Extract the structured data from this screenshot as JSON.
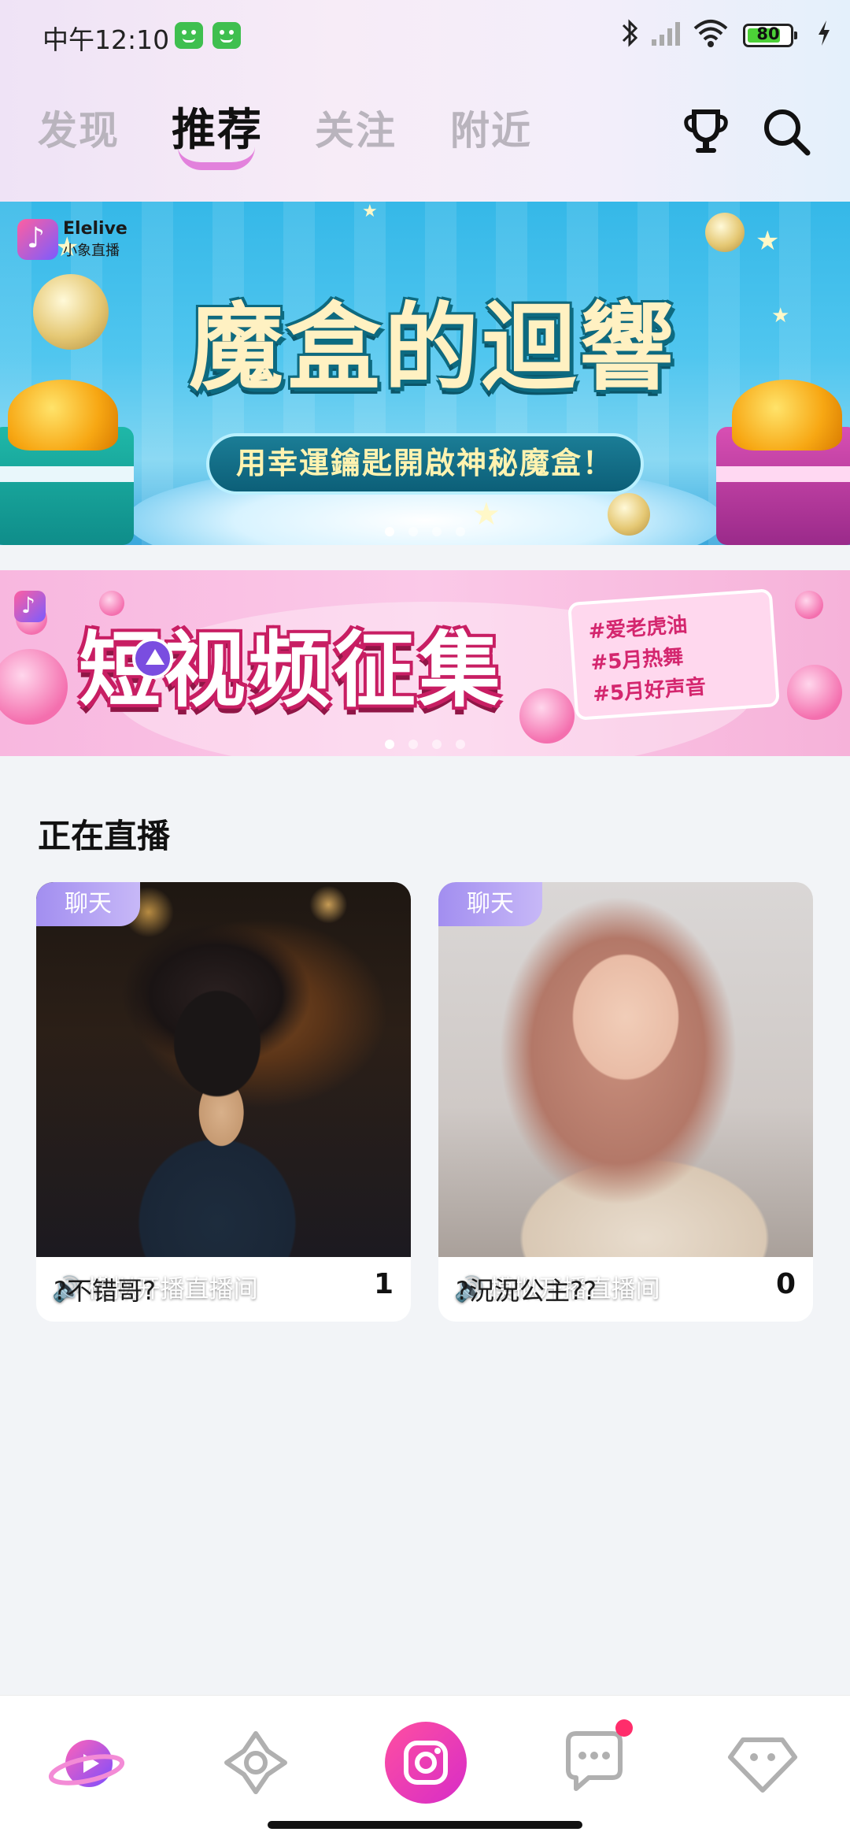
{
  "status_bar": {
    "time": "中午12:10",
    "battery": "80"
  },
  "tabs": [
    {
      "label": "发现",
      "active": false
    },
    {
      "label": "推荐",
      "active": true
    },
    {
      "label": "关注",
      "active": false
    },
    {
      "label": "附近",
      "active": false
    }
  ],
  "header_icons": [
    "trophy-icon",
    "search-icon"
  ],
  "banner1": {
    "brand_name": "Elelive",
    "brand_sub": "小象直播",
    "title": "魔盒的迴響",
    "subtitle": "用幸運鑰匙開啟神秘魔盒！",
    "dots_total": 4,
    "active_dot": 0
  },
  "banner2": {
    "title": "短视频征集",
    "tags": [
      "#爱老虎油",
      "#5月热舞",
      "#5月好声音"
    ],
    "dots_total": 4,
    "active_dot": 0
  },
  "live_section": {
    "title": "正在直播",
    "cards": [
      {
        "tag": "聊天",
        "caption": "模拟开播直播间",
        "name": "?不错哥?",
        "count": "1"
      },
      {
        "tag": "聊天",
        "caption": "模拟开播直播间",
        "name": "?況況公主??",
        "count": "0"
      }
    ]
  },
  "bottom_nav": {
    "items": [
      "live-planet-icon",
      "plaza-icon",
      "camera-icon",
      "chat-icon",
      "diamond-icon"
    ],
    "chat_has_badge": true
  },
  "colors": {
    "accent": "#e94fd6",
    "tab_inactive": "#b9b4bd",
    "tag_purple": "#a28ef0",
    "badge_red": "#ff2d6b"
  }
}
